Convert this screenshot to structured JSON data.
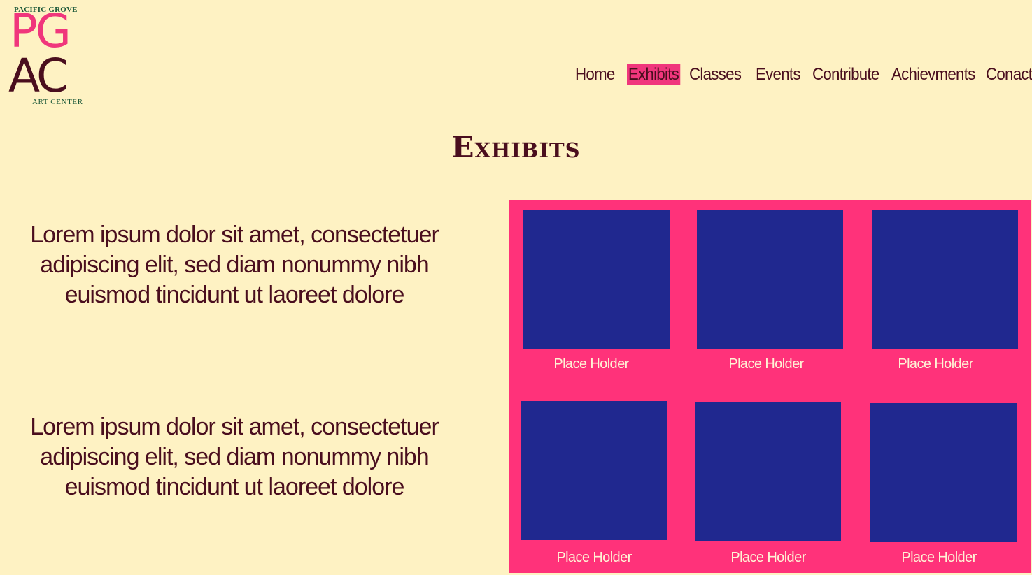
{
  "logo": {
    "top_text": "PACIFIC GROVE",
    "line1": "PG",
    "line2": "AC",
    "bottom_text": "ART CENTER"
  },
  "nav": {
    "items": [
      {
        "label": "Home"
      },
      {
        "label": "Exhibits",
        "active": true
      },
      {
        "label": "Classes"
      },
      {
        "label": "Events"
      },
      {
        "label": "Contribute"
      },
      {
        "label": "Achievments"
      },
      {
        "label": "Conact"
      }
    ]
  },
  "page": {
    "title": "Exhibits"
  },
  "content": {
    "paragraphs": [
      "Lorem ipsum dolor sit amet, consectetuer adipiscing elit, sed diam nonummy nibh euismod tincidunt ut laoreet dolore",
      "Lorem ipsum dolor sit amet, consectetuer adipiscing elit, sed diam nonummy nibh euismod tincidunt ut laoreet dolore"
    ]
  },
  "gallery": {
    "items": [
      {
        "caption": "Place Holder"
      },
      {
        "caption": "Place Holder"
      },
      {
        "caption": "Place Holder"
      },
      {
        "caption": "Place Holder"
      },
      {
        "caption": "Place Holder"
      },
      {
        "caption": "Place Holder"
      }
    ]
  },
  "colors": {
    "background": "#FEF2C3",
    "accent": "#F0367C",
    "text": "#4A0E1E",
    "tile": "#20288F"
  }
}
